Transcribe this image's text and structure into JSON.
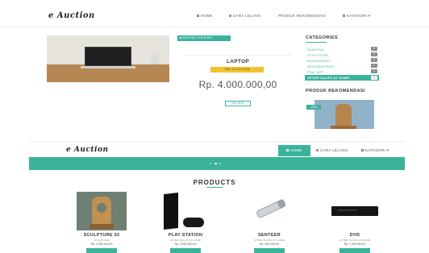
{
  "top_header": {
    "logo": "e Auction",
    "nav": [
      {
        "icon": "home-icon",
        "label": "HOME"
      },
      {
        "icon": "info-icon",
        "label": "CARA LELANG"
      },
      {
        "icon": "",
        "label": "PRODUK REKOMENDASI"
      },
      {
        "icon": "grid-icon",
        "label": "KATEGORI ▾"
      }
    ]
  },
  "detail": {
    "tag": "BIDDING FINISHED",
    "title": "LAPTOP",
    "badge": "END: 11 JULY 2018",
    "price": "Rp. 4.000.000,00",
    "button": "BID NOW"
  },
  "categories": {
    "title": "CATEGORIES",
    "items": [
      {
        "label": "PAINTING",
        "count": "0"
      },
      {
        "label": "SCULPTURE",
        "count": "0"
      },
      {
        "label": "WOODCRAFT",
        "count": "0"
      },
      {
        "label": "WOODENCRAFT",
        "count": "0"
      },
      {
        "label": "FINE ART",
        "count": "0"
      },
      {
        "label": "AFTER SALES AT HOME",
        "count": "0"
      }
    ]
  },
  "recommend": {
    "title": "PRODUK REKOMENDASI",
    "tag": "1 BID"
  },
  "second_header": {
    "logo": "e Auction",
    "nav": [
      {
        "icon": "home-icon",
        "label": "HOME"
      },
      {
        "icon": "info-icon",
        "label": "CARA LELANG"
      },
      {
        "icon": "grid-icon",
        "label": "KATEGORI ▾"
      }
    ]
  },
  "products": {
    "heading": "PRODUCTS",
    "items": [
      {
        "name": "SCULPTURE 02",
        "sub": "SCULPTURE",
        "price": "Rp. 2.000.000,00"
      },
      {
        "name": "PLAY STATION",
        "sub": "AFTER SALES AT HOME",
        "price": "Rp. 3.000.000,00"
      },
      {
        "name": "SENTEER",
        "sub": "AFTER SALES AT HOME",
        "price": "Rp. 500.000,00"
      },
      {
        "name": "DVD",
        "sub": "AFTER SALES AT HOME",
        "price": "Rp. 1.000.000,00"
      }
    ]
  },
  "colors": {
    "accent": "#3bb39b",
    "badge_yellow": "#f2c230"
  }
}
